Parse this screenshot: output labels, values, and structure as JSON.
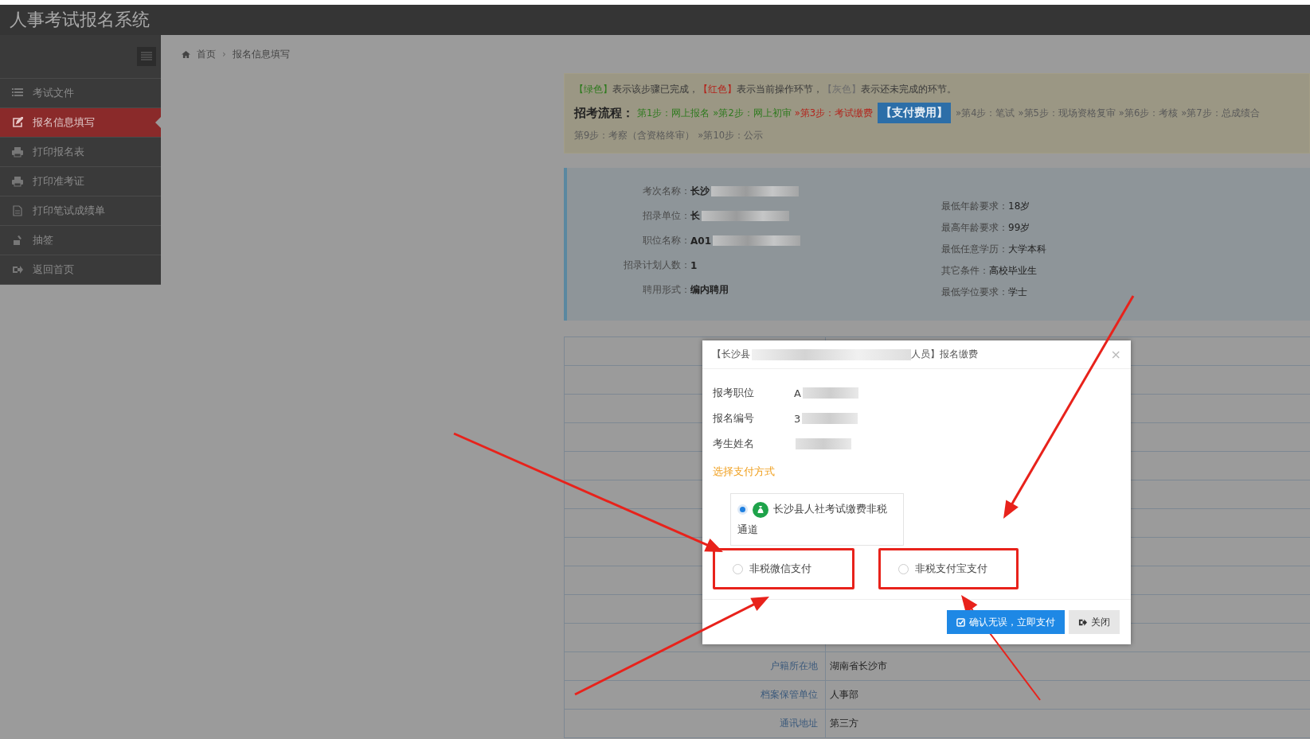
{
  "app_title": "人事考试报名系统",
  "sidebar": {
    "items": [
      {
        "label": "考试文件",
        "selected": false
      },
      {
        "label": "报名信息填写",
        "selected": true
      },
      {
        "label": "打印报名表",
        "selected": false
      },
      {
        "label": "打印准考证",
        "selected": false
      },
      {
        "label": "打印笔试成绩单",
        "selected": false
      },
      {
        "label": "抽签",
        "selected": false
      },
      {
        "label": "返回首页",
        "selected": false
      }
    ]
  },
  "breadcrumb": {
    "items": [
      "首页",
      "报名信息填写"
    ],
    "separator": "›"
  },
  "legend": [
    {
      "text": "【绿色】",
      "color": "#2f7a1f"
    },
    {
      "text": "表示该步骤已完成，",
      "color": "#3a3a3a"
    },
    {
      "text": "【红色】",
      "color": "#b3241c"
    },
    {
      "text": "表示当前操作环节，",
      "color": "#3a3a3a"
    },
    {
      "text": "【灰色】",
      "color": "#6e6e6e"
    },
    {
      "text": "表示还未完成的环节。",
      "color": "#3a3a3a"
    }
  ],
  "flow": {
    "label": "招考流程：",
    "rows": [
      [
        {
          "kind": "step",
          "text": "第1步：网上报名",
          "color": "#2f7a1f"
        },
        {
          "kind": "step",
          "prefix": "»",
          "text": "第2步：网上初审",
          "color": "#2f7a1f"
        },
        {
          "kind": "step",
          "prefix": "»",
          "text": "第3步：考试缴费",
          "color": "#b3241c"
        },
        {
          "kind": "action",
          "text": "【支付费用】"
        },
        {
          "kind": "step",
          "prefix": "»",
          "text": "第4步：笔试",
          "color": "#5a5a5a"
        },
        {
          "kind": "step",
          "prefix": "»",
          "text": "第5步：现场资格复审",
          "color": "#5a5a5a"
        },
        {
          "kind": "step",
          "prefix": "»",
          "text": "第6步：考核",
          "color": "#5a5a5a"
        },
        {
          "kind": "step",
          "prefix": "»",
          "text": "第7步：总成绩合",
          "color": "#5a5a5a"
        }
      ],
      [
        {
          "kind": "step",
          "text": "第9步：考察（含资格终审）",
          "color": "#5a5a5a"
        },
        {
          "kind": "step",
          "prefix": "»",
          "text": "第10步：公示",
          "color": "#5a5a5a"
        }
      ]
    ]
  },
  "info": {
    "left": [
      {
        "label": "考次名称：",
        "value": "长沙",
        "redacted": true
      },
      {
        "label": "招录单位：",
        "value": "长",
        "redacted": true
      },
      {
        "label": "职位名称：",
        "value": "A01",
        "redacted": true
      },
      {
        "label": "招录计划人数：",
        "value": "1",
        "redacted": false
      },
      {
        "label": "聘用形式：",
        "value": "编内聘用",
        "redacted": false
      }
    ],
    "right": [
      {
        "label": "最低年龄要求：",
        "value": "18岁"
      },
      {
        "label": "最高年龄要求：",
        "value": "99岁"
      },
      {
        "label": "最低任意学历：",
        "value": "大学本科"
      },
      {
        "label": "其它条件：",
        "value": "高校毕业生"
      },
      {
        "label": "最低学位要求：",
        "value": "学士"
      }
    ]
  },
  "table": {
    "rows": [
      {
        "label": "户籍所在地",
        "value": "湖南省长沙市"
      },
      {
        "label": "档案保管单位",
        "value": "人事部"
      },
      {
        "label": "通讯地址",
        "value": "第三方"
      }
    ]
  },
  "modal": {
    "title_start": "【长沙县",
    "title_end": "人员】报名缴费",
    "close": "×",
    "fields": [
      {
        "label": "报考职位",
        "value": "A"
      },
      {
        "label": "报名编号",
        "value": "3"
      },
      {
        "label": "考生姓名"
      }
    ],
    "section": "选择支付方式",
    "options": [
      {
        "kind": "channel",
        "label": "长沙县人社考试缴费非税通道",
        "selected": true,
        "highlighted": false
      },
      {
        "kind": "plain",
        "label": "非税微信支付",
        "selected": false,
        "highlighted": true
      },
      {
        "kind": "plain",
        "label": "非税支付宝支付",
        "selected": false,
        "highlighted": true
      }
    ],
    "buttons": [
      {
        "kind": "primary",
        "label": "确认无误，立即支付"
      },
      {
        "kind": "default",
        "label": "关闭"
      }
    ]
  }
}
